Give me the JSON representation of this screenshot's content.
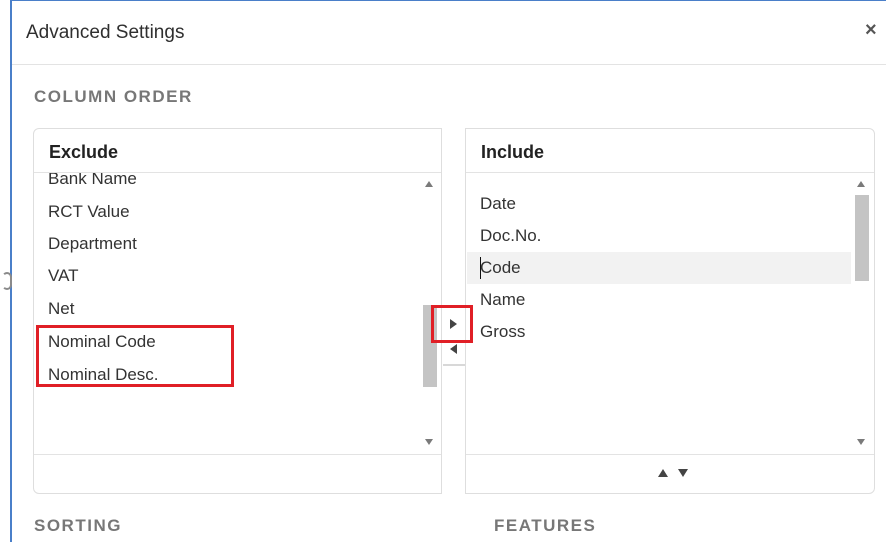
{
  "dialog": {
    "title": "Advanced Settings",
    "close_icon": "close-icon",
    "close_glyph": "×"
  },
  "sections": {
    "column_order": "COLUMN ORDER",
    "sorting": "SORTING",
    "features": "FEATURES"
  },
  "exclude": {
    "header": "Exclude",
    "items": [
      "Bank Name",
      "RCT Value",
      "Department",
      "VAT",
      "Net",
      "Nominal Code",
      "Nominal Desc."
    ]
  },
  "include": {
    "header": "Include",
    "items": [
      "Date",
      "Doc.No.",
      "Code",
      "Name",
      "Gross"
    ],
    "selected_item": "Code"
  },
  "colors": {
    "highlight_border": "#e01f26",
    "window_edge": "#4a7fc9"
  }
}
